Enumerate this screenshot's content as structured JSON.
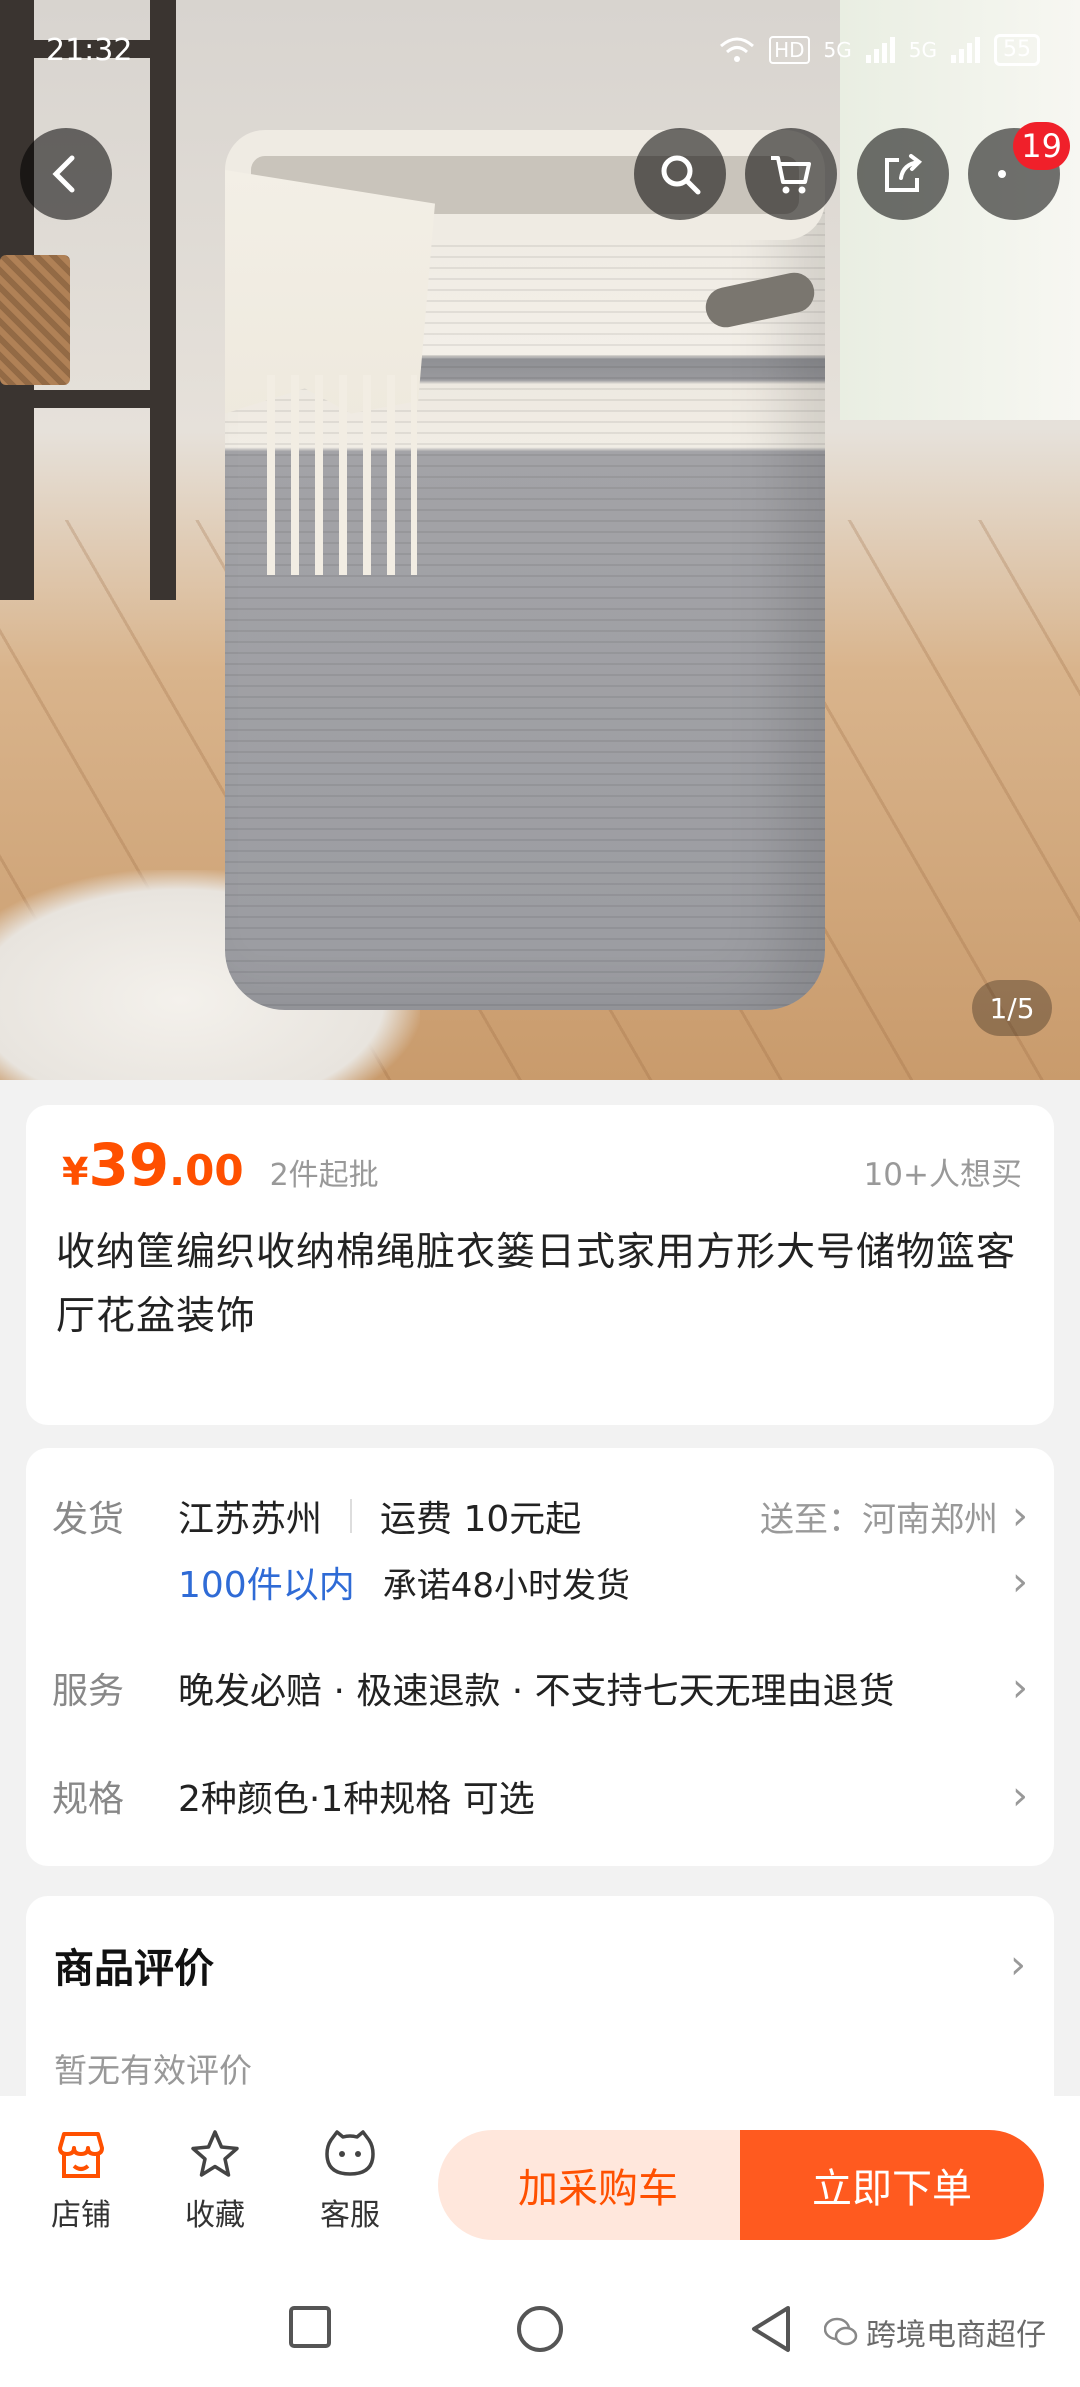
{
  "status_bar": {
    "time": "21:32",
    "net_hd": "HD",
    "net_5g_1": "5G",
    "net_5g_2": "5G",
    "battery": "55"
  },
  "top_nav": {
    "cart_count": "19"
  },
  "gallery": {
    "counter": "1/5"
  },
  "product": {
    "currency": "¥",
    "price_int": "39",
    "price_dec": ".00",
    "moq": "2件起批",
    "wanted": "10+人想买",
    "title": "收纳筐编织收纳棉绳脏衣篓日式家用方形大号储物篮客厅花盆装饰"
  },
  "shipping": {
    "label": "发货",
    "origin": "江苏苏州",
    "fee": "运费 10元起",
    "deliver_to": "送至：河南郑州",
    "quantity": "100件以内",
    "promise": "承诺48小时发货"
  },
  "service": {
    "label": "服务",
    "text": "晚发必赔 · 极速退款 · 不支持七天无理由退货"
  },
  "spec": {
    "label": "规格",
    "text": "2种颜色·1种规格 可选"
  },
  "reviews": {
    "title": "商品评价",
    "empty": "暂无有效评价"
  },
  "action_bar": {
    "store": "店铺",
    "favorite": "收藏",
    "service": "客服",
    "add_cart": "加采购车",
    "buy_now": "立即下单"
  },
  "watermark": "跨境电商超仔",
  "colors": {
    "accent": "#ff5000",
    "buy_button": "#ff5a1f",
    "cart_button_bg": "#ffe7dc",
    "badge": "#f0202a",
    "link_blue": "#2f6bd6"
  }
}
